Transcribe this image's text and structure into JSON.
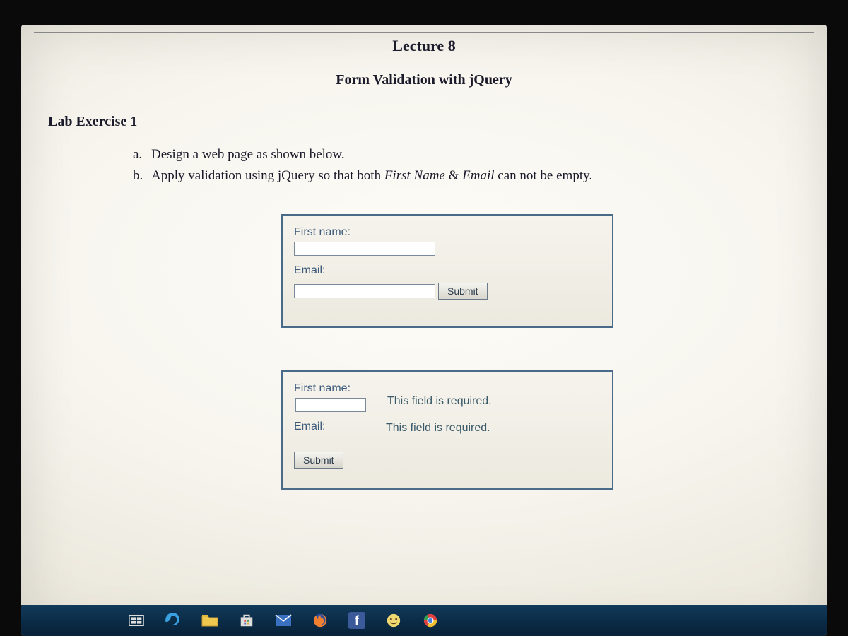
{
  "lecture_title": "Lecture 8",
  "subtitle": "Form Validation with jQuery",
  "section_heading": "Lab Exercise 1",
  "instructions": {
    "a": {
      "marker": "a.",
      "prefix": "Design a web page as shown below."
    },
    "b": {
      "marker": "b.",
      "part1": "Apply validation using jQuery so that both ",
      "italic1": "First Name",
      "amp": " & ",
      "italic2": "Email",
      "part2": " can not be empty."
    }
  },
  "form1": {
    "first_name_label": "First name:",
    "email_label": "Email:",
    "submit_label": "Submit"
  },
  "form2": {
    "first_name_label": "First name:",
    "email_label": "Email:",
    "submit_label": "Submit",
    "error1": "This field is required.",
    "error2": "This field is required."
  },
  "taskbar": {
    "fb": "f"
  }
}
